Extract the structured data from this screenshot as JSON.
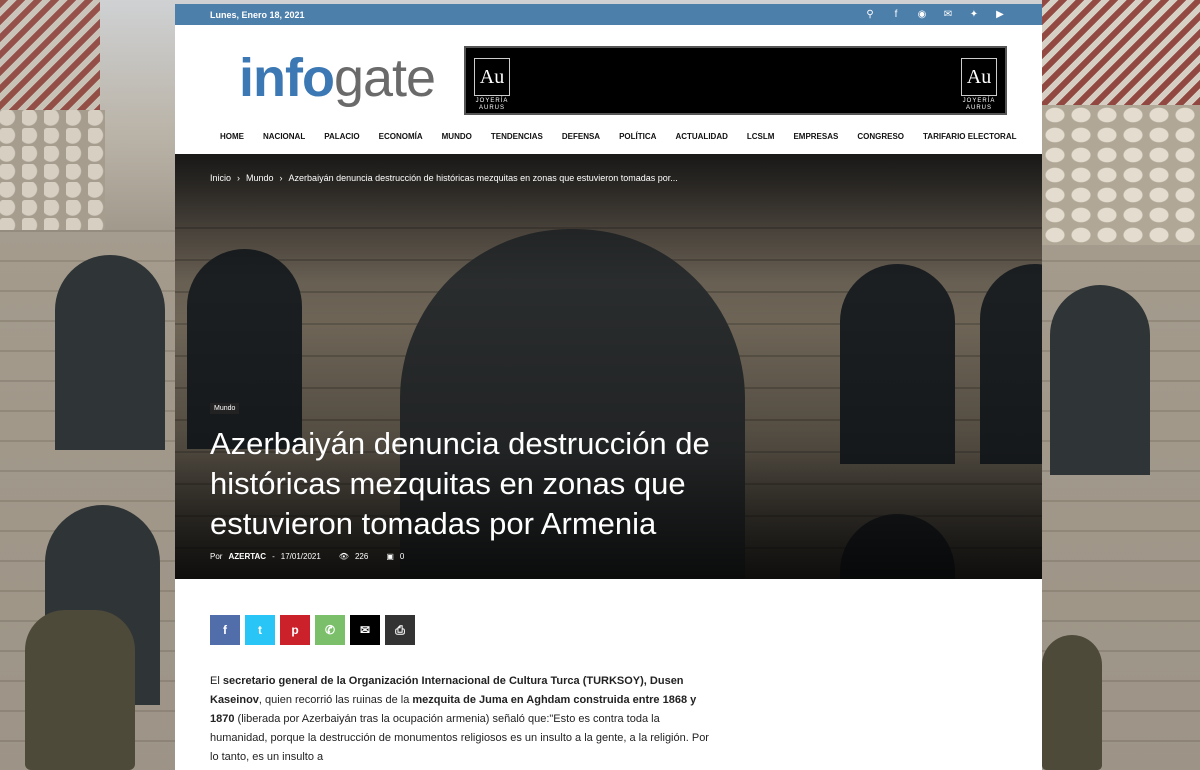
{
  "topbar": {
    "date": "Lunes, Enero 18, 2021",
    "icons": [
      "search-icon",
      "facebook-icon",
      "instagram-icon",
      "mail-icon",
      "twitter-icon",
      "youtube-icon"
    ]
  },
  "logo": {
    "part1": "info",
    "part2": "gate"
  },
  "banner": {
    "mark": "Au",
    "line1": "JOYERÍA",
    "line2": "AURUS"
  },
  "nav": [
    "HOME",
    "NACIONAL",
    "PALACIO",
    "ECONOMÍA",
    "MUNDO",
    "TENDENCIAS",
    "DEFENSA",
    "POLÍTICA",
    "ACTUALIDAD",
    "LCSLM",
    "EMPRESAS",
    "CONGRESO",
    "TARIFARIO ELECTORAL"
  ],
  "breadcrumb": {
    "home": "Inicio",
    "sep": "›",
    "section": "Mundo",
    "current": "Azerbaiyán denuncia destrucción de históricas mezquitas en zonas que estuvieron tomadas por..."
  },
  "article": {
    "category": "Mundo",
    "title": "Azerbaiyán denuncia destrucción de históricas mezquitas en zonas que estuvieron tomadas por Armenia",
    "by": "Por",
    "author": "AZERTAC",
    "dash": "-",
    "date": "17/01/2021",
    "views": "226",
    "comments": "0"
  },
  "share": [
    {
      "name": "facebook",
      "glyph": "f",
      "color": "#516eab"
    },
    {
      "name": "twitter",
      "glyph": "t",
      "color": "#29c5f6"
    },
    {
      "name": "pinterest",
      "glyph": "p",
      "color": "#ca212a"
    },
    {
      "name": "whatsapp",
      "glyph": "w",
      "color": "#7bbf6a"
    },
    {
      "name": "email",
      "glyph": "✉",
      "color": "#000000"
    },
    {
      "name": "print",
      "glyph": "⎙",
      "color": "#333333"
    }
  ],
  "body": {
    "p1_a": "El ",
    "p1_b": "secretario general de la Organización Internacional de Cultura Turca (TURKSOY), Dusen Kaseinov",
    "p1_c": ", quien recorrió las ruinas de la ",
    "p1_d": "mezquita de Juma en Aghdam construida entre 1868 y 1870",
    "p1_e": " (liberada por Azerbaiyán tras la ocupación armenia) señaló que:\"Esto es contra toda la humanidad, porque la destrucción de monumentos religiosos es un insulto a la gente, a la religión. Por lo tanto, es un insulto a"
  }
}
